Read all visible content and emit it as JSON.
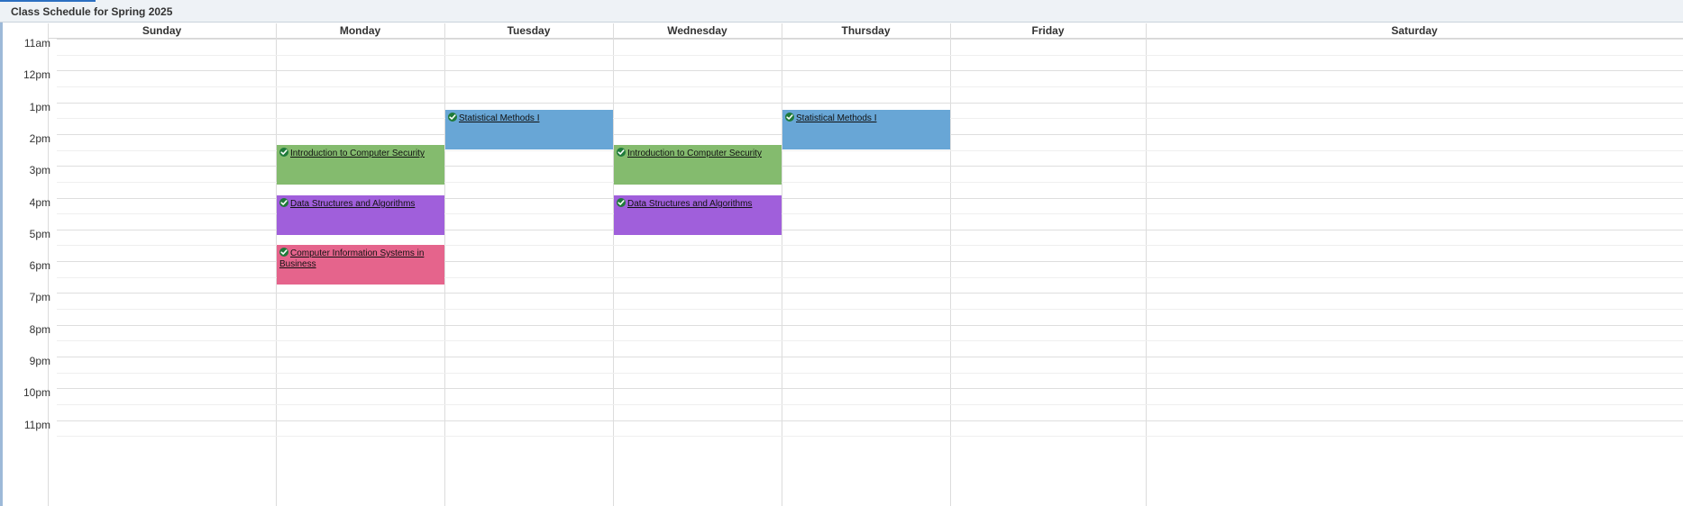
{
  "window": {
    "title": "Class Schedule for Spring 2025"
  },
  "days": [
    "Sunday",
    "Monday",
    "Tuesday",
    "Wednesday",
    "Thursday",
    "Friday",
    "Saturday"
  ],
  "hours": [
    "11am",
    "12pm",
    "1pm",
    "2pm",
    "3pm",
    "4pm",
    "5pm",
    "6pm",
    "7pm",
    "8pm",
    "9pm",
    "10pm",
    "11pm"
  ],
  "colors": {
    "statistics": "#68a6d6",
    "security": "#84bb6e",
    "algorithms": "#a05fdb",
    "business": "#e5648c"
  },
  "events": [
    {
      "title": "Statistical Methods I",
      "day": "Tuesday",
      "start": "1:15pm",
      "end": "2:30pm",
      "color": "statistics",
      "icon": "check-circle-icon"
    },
    {
      "title": "Statistical Methods I",
      "day": "Thursday",
      "start": "1:15pm",
      "end": "2:30pm",
      "color": "statistics",
      "icon": "check-circle-icon"
    },
    {
      "title": "Introduction to Computer Security",
      "day": "Monday",
      "start": "2:20pm",
      "end": "3:35pm",
      "color": "security",
      "icon": "check-circle-icon"
    },
    {
      "title": "Introduction to Computer Security",
      "day": "Wednesday",
      "start": "2:20pm",
      "end": "3:35pm",
      "color": "security",
      "icon": "check-circle-icon"
    },
    {
      "title": "Data Structures and Algorithms",
      "day": "Monday",
      "start": "3:55pm",
      "end": "5:10pm",
      "color": "algorithms",
      "icon": "check-circle-icon"
    },
    {
      "title": "Data Structures and Algorithms",
      "day": "Wednesday",
      "start": "3:55pm",
      "end": "5:10pm",
      "color": "algorithms",
      "icon": "check-circle-icon"
    },
    {
      "title": "Computer Information Systems in Business",
      "day": "Monday",
      "start": "5:30pm",
      "end": "6:45pm",
      "color": "business",
      "icon": "check-circle-icon"
    }
  ]
}
